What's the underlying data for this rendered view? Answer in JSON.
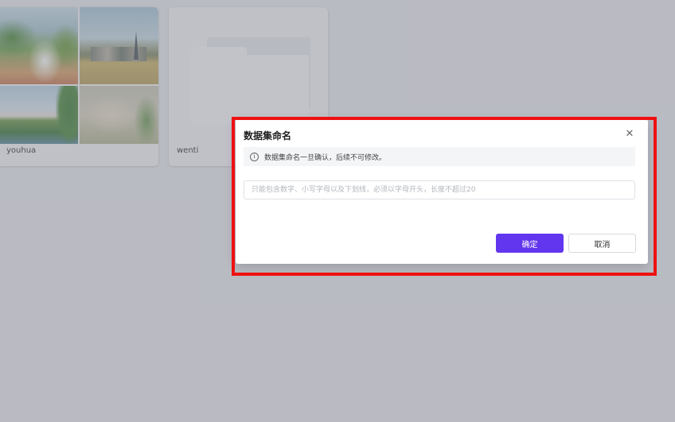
{
  "datasets": [
    {
      "name": "youhua",
      "thumbnail": "landscape-painting-collage"
    },
    {
      "name": "wenti",
      "thumbnail": "folder-icon"
    }
  ],
  "dialog": {
    "title": "数据集命名",
    "close_icon": "close-icon",
    "notice_icon": "info-icon",
    "notice": "数据集命名一旦确认，后续不可修改。",
    "input_value": "",
    "input_placeholder": "只能包含数字、小写字母以及下划线，必须以字母开头，长度不超过20",
    "confirm_label": "确定",
    "cancel_label": "取消"
  },
  "colors": {
    "primary": "#6236ef",
    "highlight_border": "#ee1111",
    "overlay": "#787a86"
  }
}
